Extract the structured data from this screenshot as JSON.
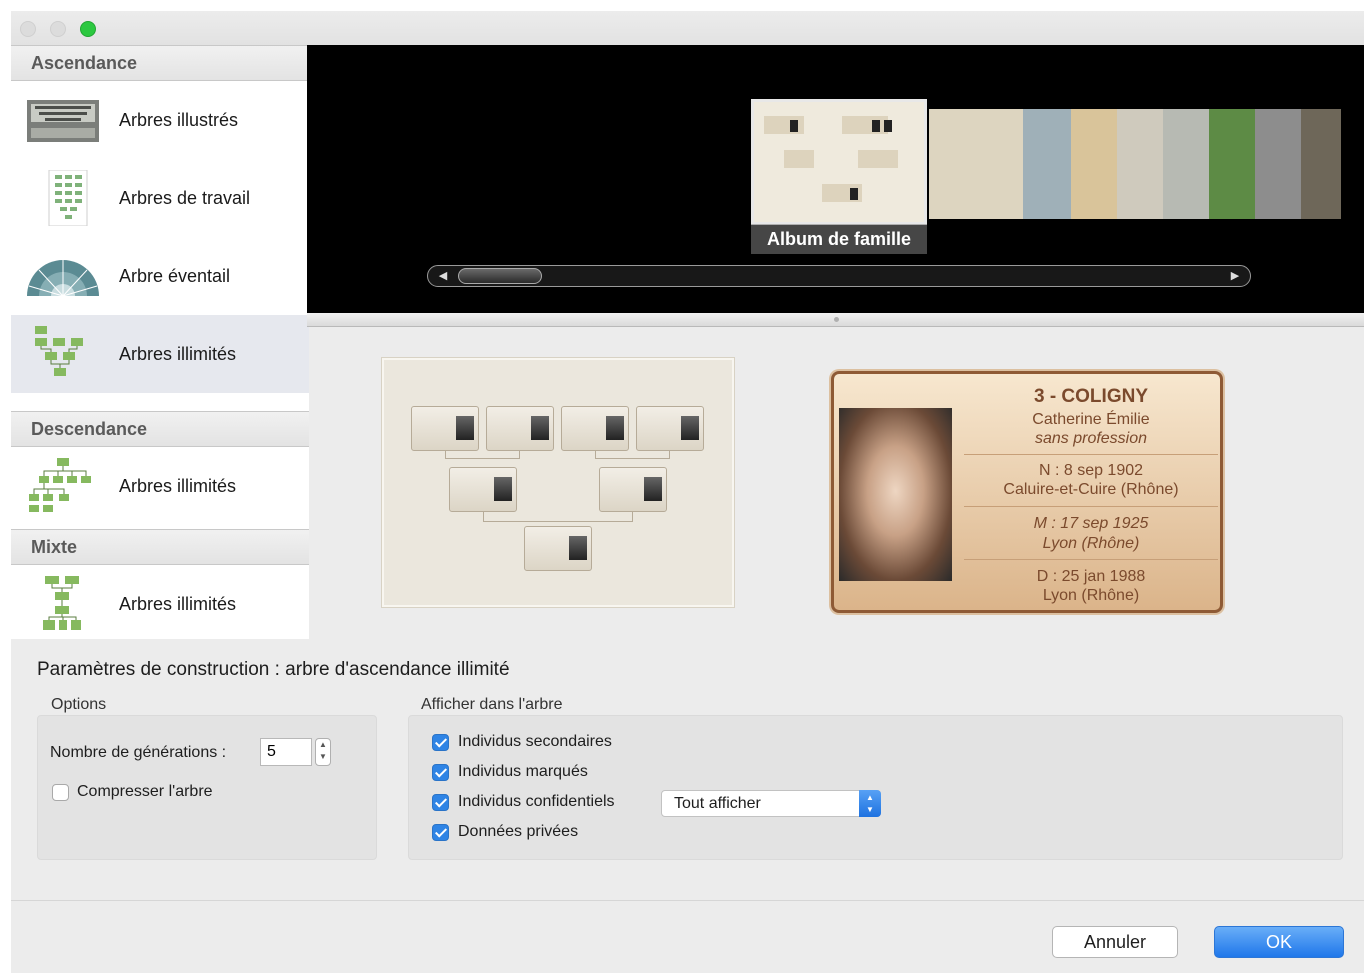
{
  "sidebar": {
    "sections": [
      {
        "title": "Ascendance",
        "items": [
          {
            "label": "Arbres illustrés",
            "icon": "illustrated-tree-icon"
          },
          {
            "label": "Arbres de travail",
            "icon": "work-tree-icon"
          },
          {
            "label": "Arbre éventail",
            "icon": "fan-tree-icon"
          },
          {
            "label": "Arbres illimités",
            "icon": "unlimited-tree-icon",
            "selected": true
          }
        ]
      },
      {
        "title": "Descendance",
        "items": [
          {
            "label": "Arbres illimités",
            "icon": "descendant-tree-icon"
          }
        ]
      },
      {
        "title": "Mixte",
        "items": [
          {
            "label": "Arbres illimités",
            "icon": "mixed-tree-icon"
          }
        ]
      }
    ]
  },
  "coverflow": {
    "caption": "Album de famille"
  },
  "card": {
    "title": "3 - COLIGNY",
    "name": "Catherine Émilie",
    "occupation": "sans profession",
    "birth": "N : 8 sep 1902",
    "birth_place": "Caluire-et-Cuire (Rhône)",
    "marriage": "M : 17 sep 1925",
    "marriage_place": "Lyon (Rhône)",
    "death": "D : 25 jan 1988",
    "death_place": "Lyon (Rhône)"
  },
  "params": {
    "title": "Paramètres de construction : arbre d'ascendance illimité",
    "options": {
      "title": "Options",
      "generations_label": "Nombre de générations :",
      "generations_value": "5",
      "compress_label": "Compresser l'arbre",
      "compress_checked": false
    },
    "display": {
      "title": "Afficher dans l'arbre",
      "items": [
        {
          "label": "Individus secondaires",
          "checked": true
        },
        {
          "label": "Individus marqués",
          "checked": true
        },
        {
          "label": "Individus confidentiels",
          "checked": true
        },
        {
          "label": "Données privées",
          "checked": true
        }
      ],
      "select_value": "Tout afficher"
    }
  },
  "buttons": {
    "cancel": "Annuler",
    "ok": "OK"
  },
  "colors": {
    "accent": "#2f84e5",
    "card_text": "#7b4a2d",
    "card_border": "#8e5a35"
  }
}
